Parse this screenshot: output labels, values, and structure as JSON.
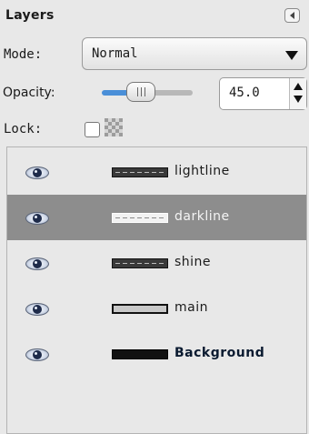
{
  "panel": {
    "title": "Layers"
  },
  "mode": {
    "label": "Mode:",
    "value": "Normal"
  },
  "opacity": {
    "label": "Opacity:",
    "value": "45.0",
    "level": 0.45
  },
  "lock": {
    "label": "Lock:",
    "checked": false
  },
  "layers": [
    {
      "name": "lightline",
      "visible": true,
      "selected": false,
      "bold": false
    },
    {
      "name": "darkline",
      "visible": true,
      "selected": true,
      "bold": false
    },
    {
      "name": "shine",
      "visible": true,
      "selected": false,
      "bold": false
    },
    {
      "name": "main",
      "visible": true,
      "selected": false,
      "bold": false
    },
    {
      "name": "Background",
      "visible": true,
      "selected": false,
      "bold": true
    }
  ],
  "icons": {
    "visibility": "eye-icon",
    "panel_menu": "panel-menu-icon",
    "dropdown": "chevron-down-icon",
    "alpha_lock": "alpha-lock-icon"
  },
  "colors": {
    "accent": "#4a8fd8",
    "selected_row": "#8d8d8d",
    "background": "#e8e8e8"
  }
}
